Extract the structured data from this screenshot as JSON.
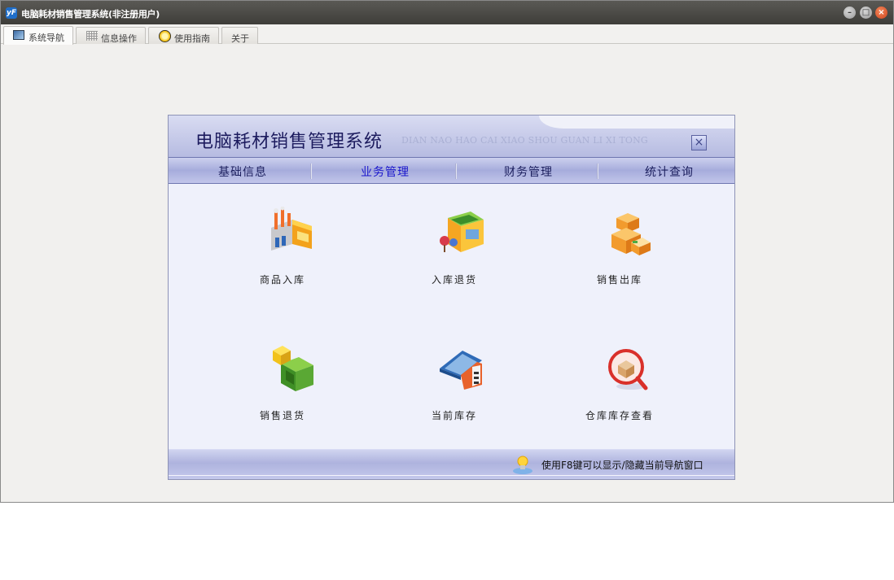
{
  "window": {
    "title": "电脑耗材销售管理系统(非注册用户)",
    "app_icon_text": "yF",
    "controls": {
      "minimize": "–",
      "maximize": "□",
      "close": "×"
    }
  },
  "tabs": [
    {
      "label": "系统导航",
      "icon": "monitor-icon",
      "active": true
    },
    {
      "label": "信息操作",
      "icon": "grid-icon",
      "active": false
    },
    {
      "label": "使用指南",
      "icon": "help-icon",
      "active": false
    },
    {
      "label": "关于",
      "icon": "",
      "active": false
    }
  ],
  "panel": {
    "title": "电脑耗材销售管理系统",
    "subtitle": "DIAN NAO HAO CAI XIAO SHOU GUAN LI XI TONG",
    "close_symbol": "×",
    "menu": [
      {
        "label": "基础信息",
        "active": false
      },
      {
        "label": "业务管理",
        "active": true
      },
      {
        "label": "财务管理",
        "active": false
      },
      {
        "label": "统计查询",
        "active": false
      }
    ],
    "items": [
      {
        "label": "商品入库",
        "icon": "factory-icon"
      },
      {
        "label": "入库退货",
        "icon": "shop-icon"
      },
      {
        "label": "销售出库",
        "icon": "boxes-icon"
      },
      {
        "label": "销售退货",
        "icon": "box-return-icon"
      },
      {
        "label": "当前库存",
        "icon": "warehouse-icon"
      },
      {
        "label": "仓库库存查看",
        "icon": "magnifier-box-icon"
      }
    ],
    "footer_text": "使用F8键可以显示/隐藏当前导航窗口"
  },
  "colors": {
    "title_text": "#1c1b5e",
    "active_menu": "#1a16cc",
    "panel_bg": "#eff1fb",
    "titlebar": "#4a4945"
  }
}
